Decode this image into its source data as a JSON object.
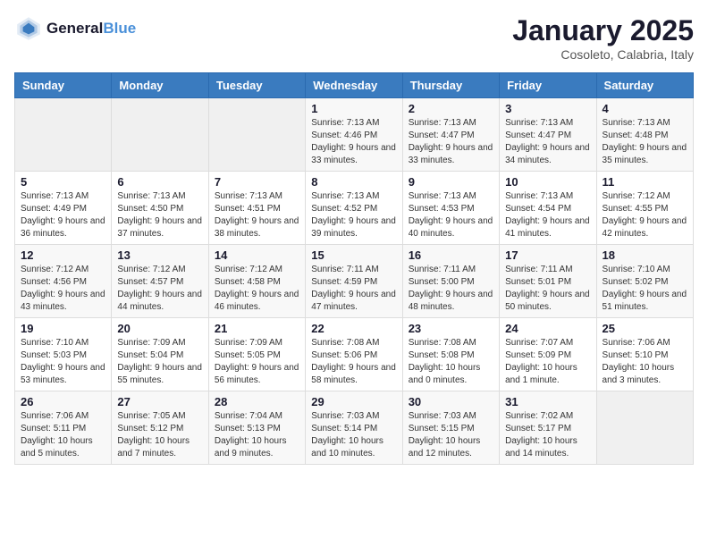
{
  "header": {
    "logo_line1": "General",
    "logo_line2": "Blue",
    "month": "January 2025",
    "location": "Cosoleto, Calabria, Italy"
  },
  "weekdays": [
    "Sunday",
    "Monday",
    "Tuesday",
    "Wednesday",
    "Thursday",
    "Friday",
    "Saturday"
  ],
  "weeks": [
    [
      {
        "day": "",
        "info": ""
      },
      {
        "day": "",
        "info": ""
      },
      {
        "day": "",
        "info": ""
      },
      {
        "day": "1",
        "info": "Sunrise: 7:13 AM\nSunset: 4:46 PM\nDaylight: 9 hours and 33 minutes."
      },
      {
        "day": "2",
        "info": "Sunrise: 7:13 AM\nSunset: 4:47 PM\nDaylight: 9 hours and 33 minutes."
      },
      {
        "day": "3",
        "info": "Sunrise: 7:13 AM\nSunset: 4:47 PM\nDaylight: 9 hours and 34 minutes."
      },
      {
        "day": "4",
        "info": "Sunrise: 7:13 AM\nSunset: 4:48 PM\nDaylight: 9 hours and 35 minutes."
      }
    ],
    [
      {
        "day": "5",
        "info": "Sunrise: 7:13 AM\nSunset: 4:49 PM\nDaylight: 9 hours and 36 minutes."
      },
      {
        "day": "6",
        "info": "Sunrise: 7:13 AM\nSunset: 4:50 PM\nDaylight: 9 hours and 37 minutes."
      },
      {
        "day": "7",
        "info": "Sunrise: 7:13 AM\nSunset: 4:51 PM\nDaylight: 9 hours and 38 minutes."
      },
      {
        "day": "8",
        "info": "Sunrise: 7:13 AM\nSunset: 4:52 PM\nDaylight: 9 hours and 39 minutes."
      },
      {
        "day": "9",
        "info": "Sunrise: 7:13 AM\nSunset: 4:53 PM\nDaylight: 9 hours and 40 minutes."
      },
      {
        "day": "10",
        "info": "Sunrise: 7:13 AM\nSunset: 4:54 PM\nDaylight: 9 hours and 41 minutes."
      },
      {
        "day": "11",
        "info": "Sunrise: 7:12 AM\nSunset: 4:55 PM\nDaylight: 9 hours and 42 minutes."
      }
    ],
    [
      {
        "day": "12",
        "info": "Sunrise: 7:12 AM\nSunset: 4:56 PM\nDaylight: 9 hours and 43 minutes."
      },
      {
        "day": "13",
        "info": "Sunrise: 7:12 AM\nSunset: 4:57 PM\nDaylight: 9 hours and 44 minutes."
      },
      {
        "day": "14",
        "info": "Sunrise: 7:12 AM\nSunset: 4:58 PM\nDaylight: 9 hours and 46 minutes."
      },
      {
        "day": "15",
        "info": "Sunrise: 7:11 AM\nSunset: 4:59 PM\nDaylight: 9 hours and 47 minutes."
      },
      {
        "day": "16",
        "info": "Sunrise: 7:11 AM\nSunset: 5:00 PM\nDaylight: 9 hours and 48 minutes."
      },
      {
        "day": "17",
        "info": "Sunrise: 7:11 AM\nSunset: 5:01 PM\nDaylight: 9 hours and 50 minutes."
      },
      {
        "day": "18",
        "info": "Sunrise: 7:10 AM\nSunset: 5:02 PM\nDaylight: 9 hours and 51 minutes."
      }
    ],
    [
      {
        "day": "19",
        "info": "Sunrise: 7:10 AM\nSunset: 5:03 PM\nDaylight: 9 hours and 53 minutes."
      },
      {
        "day": "20",
        "info": "Sunrise: 7:09 AM\nSunset: 5:04 PM\nDaylight: 9 hours and 55 minutes."
      },
      {
        "day": "21",
        "info": "Sunrise: 7:09 AM\nSunset: 5:05 PM\nDaylight: 9 hours and 56 minutes."
      },
      {
        "day": "22",
        "info": "Sunrise: 7:08 AM\nSunset: 5:06 PM\nDaylight: 9 hours and 58 minutes."
      },
      {
        "day": "23",
        "info": "Sunrise: 7:08 AM\nSunset: 5:08 PM\nDaylight: 10 hours and 0 minutes."
      },
      {
        "day": "24",
        "info": "Sunrise: 7:07 AM\nSunset: 5:09 PM\nDaylight: 10 hours and 1 minute."
      },
      {
        "day": "25",
        "info": "Sunrise: 7:06 AM\nSunset: 5:10 PM\nDaylight: 10 hours and 3 minutes."
      }
    ],
    [
      {
        "day": "26",
        "info": "Sunrise: 7:06 AM\nSunset: 5:11 PM\nDaylight: 10 hours and 5 minutes."
      },
      {
        "day": "27",
        "info": "Sunrise: 7:05 AM\nSunset: 5:12 PM\nDaylight: 10 hours and 7 minutes."
      },
      {
        "day": "28",
        "info": "Sunrise: 7:04 AM\nSunset: 5:13 PM\nDaylight: 10 hours and 9 minutes."
      },
      {
        "day": "29",
        "info": "Sunrise: 7:03 AM\nSunset: 5:14 PM\nDaylight: 10 hours and 10 minutes."
      },
      {
        "day": "30",
        "info": "Sunrise: 7:03 AM\nSunset: 5:15 PM\nDaylight: 10 hours and 12 minutes."
      },
      {
        "day": "31",
        "info": "Sunrise: 7:02 AM\nSunset: 5:17 PM\nDaylight: 10 hours and 14 minutes."
      },
      {
        "day": "",
        "info": ""
      }
    ]
  ]
}
